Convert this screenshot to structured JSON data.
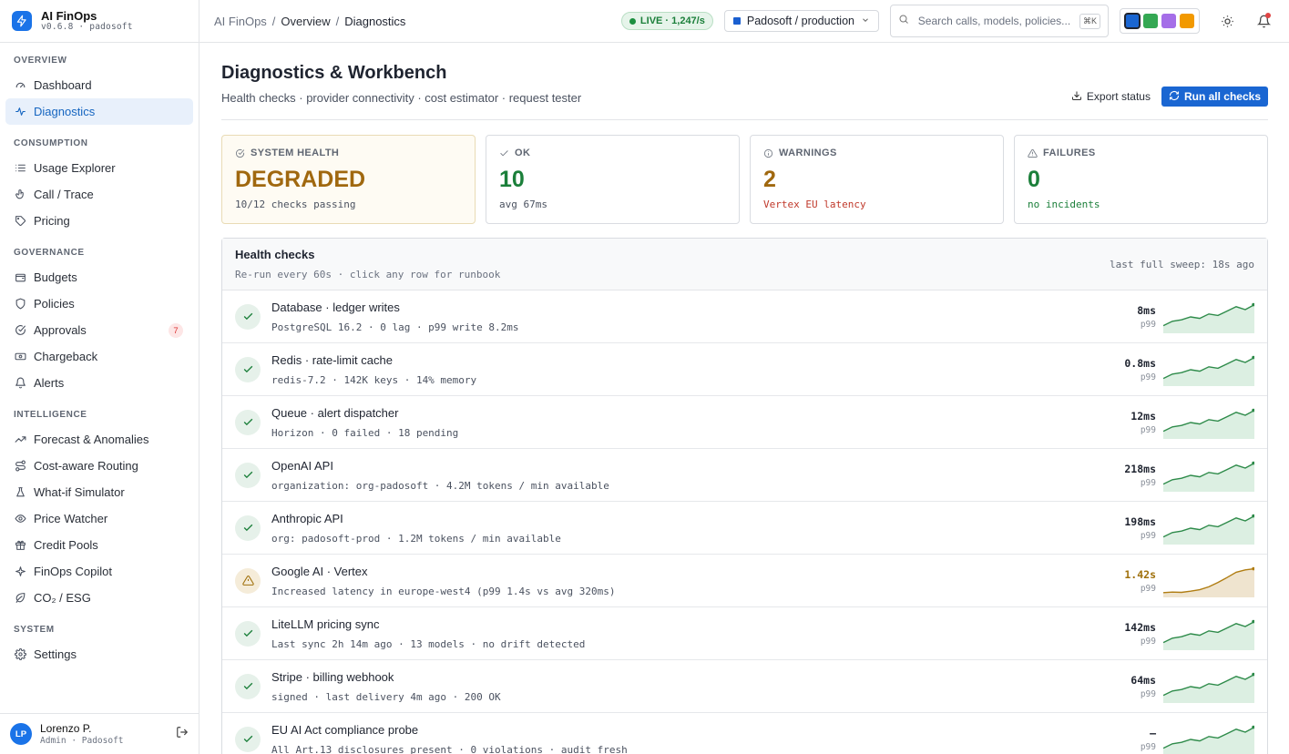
{
  "brand": {
    "name": "AI FinOps",
    "version": "v0.6.8 · padosoft"
  },
  "nav": [
    {
      "section": "OVERVIEW",
      "items": [
        {
          "label": "Dashboard",
          "icon": "gauge-icon"
        },
        {
          "label": "Diagnostics",
          "icon": "pulse-icon",
          "active": true
        }
      ]
    },
    {
      "section": "CONSUMPTION",
      "items": [
        {
          "label": "Usage Explorer",
          "icon": "list-icon"
        },
        {
          "label": "Call / Trace",
          "icon": "pointer-icon"
        },
        {
          "label": "Pricing",
          "icon": "tag-icon"
        }
      ]
    },
    {
      "section": "GOVERNANCE",
      "items": [
        {
          "label": "Budgets",
          "icon": "wallet-icon"
        },
        {
          "label": "Policies",
          "icon": "shield-icon"
        },
        {
          "label": "Approvals",
          "icon": "check-circle-icon",
          "badge": "7"
        },
        {
          "label": "Chargeback",
          "icon": "banknote-icon"
        },
        {
          "label": "Alerts",
          "icon": "bell-icon"
        }
      ]
    },
    {
      "section": "INTELLIGENCE",
      "items": [
        {
          "label": "Forecast & Anomalies",
          "icon": "trend-icon"
        },
        {
          "label": "Cost-aware Routing",
          "icon": "route-icon"
        },
        {
          "label": "What-if Simulator",
          "icon": "flask-icon"
        },
        {
          "label": "Price Watcher",
          "icon": "eye-icon"
        },
        {
          "label": "Credit Pools",
          "icon": "gift-icon"
        },
        {
          "label": "FinOps Copilot",
          "icon": "sparkle-icon"
        },
        {
          "label": "CO₂ / ESG",
          "icon": "leaf-icon"
        }
      ]
    },
    {
      "section": "SYSTEM",
      "items": [
        {
          "label": "Settings",
          "icon": "gear-icon"
        }
      ]
    }
  ],
  "user": {
    "initials": "LP",
    "name": "Lorenzo P.",
    "role": "Admin · Padosoft"
  },
  "topbar": {
    "breadcrumb": [
      "AI FinOps",
      "Overview",
      "Diagnostics"
    ],
    "live": "LIVE · 1,247/s",
    "org": "Padosoft / production",
    "search_placeholder": "Search calls, models, policies...",
    "search_kbd": "⌘K",
    "theme_swatches": [
      "#1a66d2",
      "#34a853",
      "#a56ee8",
      "#f29900"
    ]
  },
  "page": {
    "title": "Diagnostics & Workbench",
    "subtitle": "Health checks · provider connectivity · cost estimator · request tester",
    "export_label": "Export status",
    "run_label": "Run all checks"
  },
  "kpis": [
    {
      "label": "SYSTEM HEALTH",
      "value": "DEGRADED",
      "sub": "10/12 checks passing",
      "value_color": "#a0680f",
      "sub_color": "#4b5260",
      "icon": "check-circle-icon",
      "style": "warn"
    },
    {
      "label": "OK",
      "value": "10",
      "sub": "avg 67ms",
      "value_color": "#1b7f3a",
      "sub_color": "#4b5260",
      "icon": "check-icon"
    },
    {
      "label": "WARNINGS",
      "value": "2",
      "sub": "Vertex EU latency",
      "value_color": "#a0680f",
      "sub_color": "#c0392b",
      "icon": "info-icon"
    },
    {
      "label": "FAILURES",
      "value": "0",
      "sub": "no incidents",
      "value_color": "#1b7f3a",
      "sub_color": "#1b7f3a",
      "icon": "alert-triangle-icon"
    }
  ],
  "health": {
    "title": "Health checks",
    "subtitle": "Re-run every 60s · click any row for runbook",
    "meta": "last full sweep: 18s ago",
    "rows": [
      {
        "title": "Database · ledger writes",
        "detail": "PostgreSQL 16.2 · 0 lag · p99 write 8.2ms",
        "ms": "8ms",
        "p": "p99",
        "status": "ok"
      },
      {
        "title": "Redis · rate-limit cache",
        "detail": "redis-7.2 · 142K keys · 14% memory",
        "ms": "0.8ms",
        "p": "p99",
        "status": "ok"
      },
      {
        "title": "Queue · alert dispatcher",
        "detail": "Horizon · 0 failed · 18 pending",
        "ms": "12ms",
        "p": "p99",
        "status": "ok"
      },
      {
        "title": "OpenAI API",
        "detail": "organization: org-padosoft · 4.2M tokens / min available",
        "ms": "218ms",
        "p": "p99",
        "status": "ok"
      },
      {
        "title": "Anthropic API",
        "detail": "org: padosoft-prod · 1.2M tokens / min available",
        "ms": "198ms",
        "p": "p99",
        "status": "ok"
      },
      {
        "title": "Google AI · Vertex",
        "detail": "Increased latency in europe-west4 (p99 1.4s vs avg 320ms)",
        "ms": "1.42s",
        "p": "p99",
        "status": "warn"
      },
      {
        "title": "LiteLLM pricing sync",
        "detail": "Last sync 2h 14m ago · 13 models · no drift detected",
        "ms": "142ms",
        "p": "p99",
        "status": "ok"
      },
      {
        "title": "Stripe · billing webhook",
        "detail": "signed · last delivery 4m ago · 200 OK",
        "ms": "64ms",
        "p": "p99",
        "status": "ok"
      },
      {
        "title": "EU AI Act compliance probe",
        "detail": "All Art.13 disclosures present · 0 violations · audit fresh",
        "ms": "–",
        "p": "p99",
        "status": "ok"
      }
    ]
  }
}
